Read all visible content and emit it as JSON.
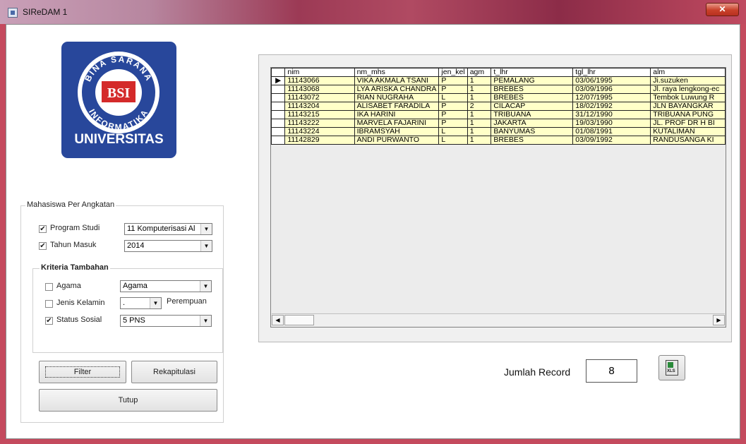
{
  "window": {
    "title": "SIReDAM 1",
    "close_glyph": "✕"
  },
  "logo": {
    "ring_text_top": "BINA SARANA",
    "ring_text_bottom": "INFORMATIKA",
    "emblem": "BSI",
    "caption": "UNIVERSITAS"
  },
  "filter": {
    "legend": "Mahasiswa Per Angkatan",
    "program_studi": {
      "label": "Program Studi",
      "checked": true,
      "value": "11  Komputerisasi Al"
    },
    "tahun_masuk": {
      "label": "Tahun Masuk",
      "checked": true,
      "value": "2014"
    },
    "kriteria": {
      "legend": "Kriteria Tambahan",
      "agama": {
        "label": "Agama",
        "checked": false,
        "value": "Agama"
      },
      "jenis_kelamin": {
        "label": "Jenis Kelamin",
        "checked": false,
        "value": ".",
        "hint": "Perempuan"
      },
      "status_sosial": {
        "label": "Status Sosial",
        "checked": true,
        "value": "5  PNS"
      }
    }
  },
  "buttons": {
    "filter": "Filter",
    "rekapitulasi": "Rekapitulasi",
    "tutup": "Tutup"
  },
  "table": {
    "columns": [
      "nim",
      "nm_mhs",
      "jen_kel",
      "agm",
      "t_lhr",
      "tgl_lhr",
      "alm"
    ],
    "rows": [
      [
        "11143066",
        "VIKA AKMALA TSANI",
        "P",
        "1",
        "PEMALANG",
        "03/06/1995",
        "Ji.suzuken"
      ],
      [
        "11143068",
        "LYA ARISKA CHANDRA",
        "P",
        "1",
        "BREBES",
        "03/09/1996",
        "Jl. raya lengkong-ec"
      ],
      [
        "11143072",
        "RIAN NUGRAHA",
        "L",
        "1",
        "BREBES",
        "12/07/1995",
        "Tembok Luwung R"
      ],
      [
        "11143204",
        "ALISABET FARADILA",
        "P",
        "2",
        "CILACAP",
        "18/02/1992",
        "JLN BAYANGKAR"
      ],
      [
        "11143215",
        "IKA HARINI",
        "P",
        "1",
        "TRIBUANA",
        "31/12/1990",
        "TRIBUANA PUNG"
      ],
      [
        "11143222",
        "MARVELA FAJARINI",
        "P",
        "1",
        "JAKARTA",
        "19/03/1990",
        "JL. PROF DR H BI"
      ],
      [
        "11143224",
        "IBRAMSYAH",
        "L",
        "1",
        "BANYUMAS",
        "01/08/1991",
        "KUTALIMAN"
      ],
      [
        "11142829",
        "ANDI PURWANTO",
        "L",
        "1",
        "BREBES",
        "03/09/1992",
        "RANDUSANGA KI"
      ]
    ],
    "row_indicator": "▶",
    "scroll_left": "◀",
    "scroll_right": "▶"
  },
  "footer": {
    "record_label": "Jumlah Record",
    "record_count": "8",
    "export_icon_text": "XLS"
  }
}
